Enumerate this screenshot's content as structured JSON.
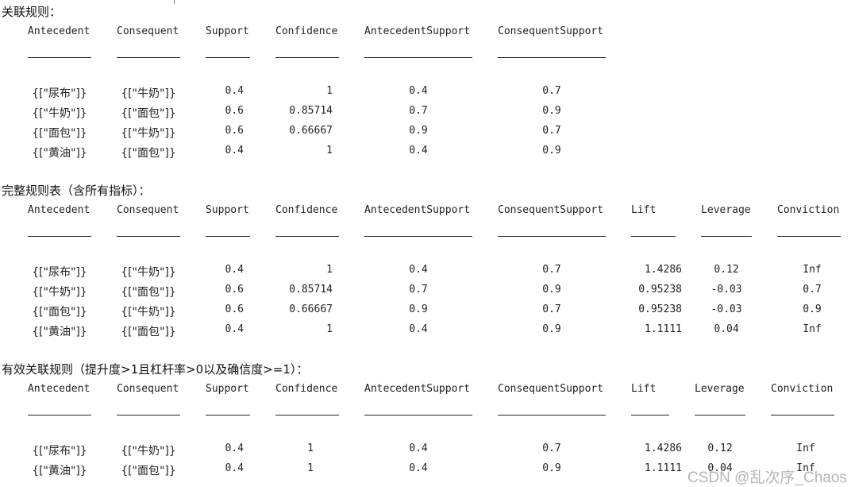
{
  "sections": [
    {
      "title": "关联规则：",
      "headers": [
        "Antecedent",
        "Consequent",
        "Support",
        "Confidence",
        "AntecedentSupport",
        "ConsequentSupport"
      ],
      "rows": [
        [
          "{[\"尿布\"]}",
          "{[\"牛奶\"]}",
          "0.4",
          "1",
          "0.4",
          "0.7"
        ],
        [
          "{[\"牛奶\"]}",
          "{[\"面包\"]}",
          "0.6",
          "0.85714",
          "0.7",
          "0.9"
        ],
        [
          "{[\"面包\"]}",
          "{[\"牛奶\"]}",
          "0.6",
          "0.66667",
          "0.9",
          "0.7"
        ],
        [
          "{[\"黄油\"]}",
          "{[\"面包\"]}",
          "0.4",
          "1",
          "0.4",
          "0.9"
        ]
      ]
    },
    {
      "title": "完整规则表（含所有指标）：",
      "headers": [
        "Antecedent",
        "Consequent",
        "Support",
        "Confidence",
        "AntecedentSupport",
        "ConsequentSupport",
        "Lift",
        "Leverage",
        "Conviction"
      ],
      "rows": [
        [
          "{[\"尿布\"]}",
          "{[\"牛奶\"]}",
          "0.4",
          "1",
          "0.4",
          "0.7",
          "1.4286",
          "0.12",
          "Inf"
        ],
        [
          "{[\"牛奶\"]}",
          "{[\"面包\"]}",
          "0.6",
          "0.85714",
          "0.7",
          "0.9",
          "0.95238",
          "-0.03",
          "0.7"
        ],
        [
          "{[\"面包\"]}",
          "{[\"牛奶\"]}",
          "0.6",
          "0.66667",
          "0.9",
          "0.7",
          "0.95238",
          "-0.03",
          "0.9"
        ],
        [
          "{[\"黄油\"]}",
          "{[\"面包\"]}",
          "0.4",
          "1",
          "0.4",
          "0.9",
          "1.1111",
          "0.04",
          "Inf"
        ]
      ]
    },
    {
      "title": "有效关联规则（提升度>1且杠杆率>0以及确信度>=1）：",
      "headers": [
        "Antecedent",
        "Consequent",
        "Support",
        "Confidence",
        "AntecedentSupport",
        "ConsequentSupport",
        "Lift",
        "Leverage",
        "Conviction"
      ],
      "rows": [
        [
          "{[\"尿布\"]}",
          "{[\"牛奶\"]}",
          "0.4",
          "1",
          "0.4",
          "0.7",
          "1.4286",
          "0.12",
          "Inf"
        ],
        [
          "{[\"黄油\"]}",
          "{[\"面包\"]}",
          "0.4",
          "1",
          "0.4",
          "0.9",
          "1.1111",
          "0.04",
          "Inf"
        ]
      ]
    }
  ],
  "watermark": "CSDN @乱次序_Chaos"
}
